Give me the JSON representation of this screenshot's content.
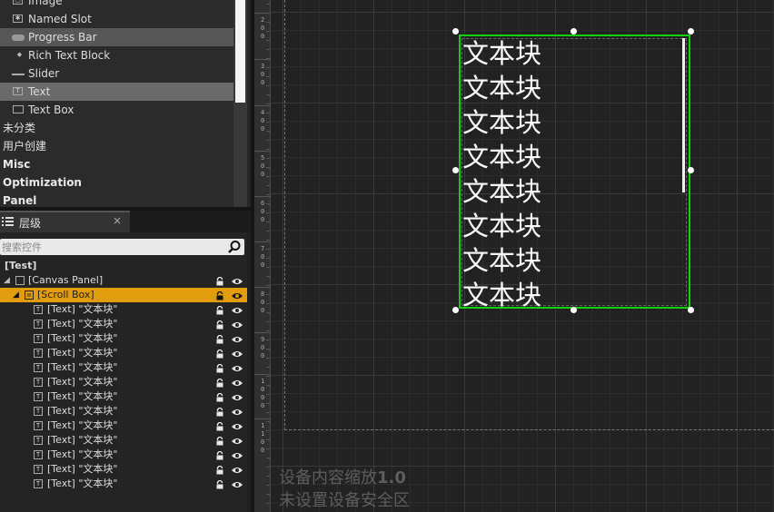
{
  "palette": {
    "items": [
      {
        "label": "Image",
        "icon": "image-icon",
        "glyph": "▢"
      },
      {
        "label": "Named Slot",
        "icon": "named-slot-icon",
        "glyph": "✱"
      },
      {
        "label": "Progress Bar",
        "icon": "progress-bar-icon",
        "glyph": ""
      },
      {
        "label": "Rich Text Block",
        "icon": "rich-text-icon",
        "glyph": "◆"
      },
      {
        "label": "Slider",
        "icon": "slider-icon",
        "glyph": ""
      },
      {
        "label": "Text",
        "icon": "text-icon",
        "glyph": "T"
      },
      {
        "label": "Text Box",
        "icon": "text-box-icon",
        "glyph": ""
      }
    ],
    "categories": [
      {
        "label": "未分类",
        "bold": false
      },
      {
        "label": "用户创建",
        "bold": false
      },
      {
        "label": "Misc",
        "bold": true
      },
      {
        "label": "Optimization",
        "bold": true
      },
      {
        "label": "Panel",
        "bold": true
      }
    ]
  },
  "hierarchy": {
    "tab_label": "层级",
    "tab_close": "×",
    "search_placeholder": "搜索控件",
    "root": "[Test]",
    "canvas_panel": "[Canvas Panel]",
    "scroll_box": "[Scroll Box]",
    "text_items": [
      "[Text] \"文本块\"",
      "[Text] \"文本块\"",
      "[Text] \"文本块\"",
      "[Text] \"文本块\"",
      "[Text] \"文本块\"",
      "[Text] \"文本块\"",
      "[Text] \"文本块\"",
      "[Text] \"文本块\"",
      "[Text] \"文本块\"",
      "[Text] \"文本块\"",
      "[Text] \"文本块\"",
      "[Text] \"文本块\"",
      "[Text] \"文本块\""
    ]
  },
  "ruler": {
    "labels": [
      {
        "chars": [
          "2",
          "0",
          "0"
        ]
      },
      {
        "chars": [
          "3",
          "0",
          "0"
        ]
      },
      {
        "chars": [
          "4",
          "0",
          "0"
        ]
      },
      {
        "chars": [
          "5",
          "0",
          "0"
        ]
      },
      {
        "chars": [
          "6",
          "0",
          "0"
        ]
      },
      {
        "chars": [
          "7",
          "0",
          "0"
        ]
      },
      {
        "chars": [
          "8",
          "0",
          "0"
        ]
      },
      {
        "chars": [
          "9",
          "0",
          "0"
        ]
      },
      {
        "chars": [
          "1",
          "0",
          "0",
          "0"
        ]
      },
      {
        "chars": [
          "1",
          "1",
          "0",
          "0"
        ]
      }
    ]
  },
  "canvas": {
    "scrollbox_texts": [
      "文本块",
      "文本块",
      "文本块",
      "文本块",
      "文本块",
      "文本块",
      "文本块",
      "文本块"
    ],
    "dpi_scale_prefix": "设备内容缩放",
    "dpi_scale_value": "1.0",
    "safe_zone": "未设置设备安全区"
  },
  "colors": {
    "selection_highlight": "#e19d0d",
    "scrollbox_outline": "#10d010",
    "palette_selected": "#575757"
  }
}
